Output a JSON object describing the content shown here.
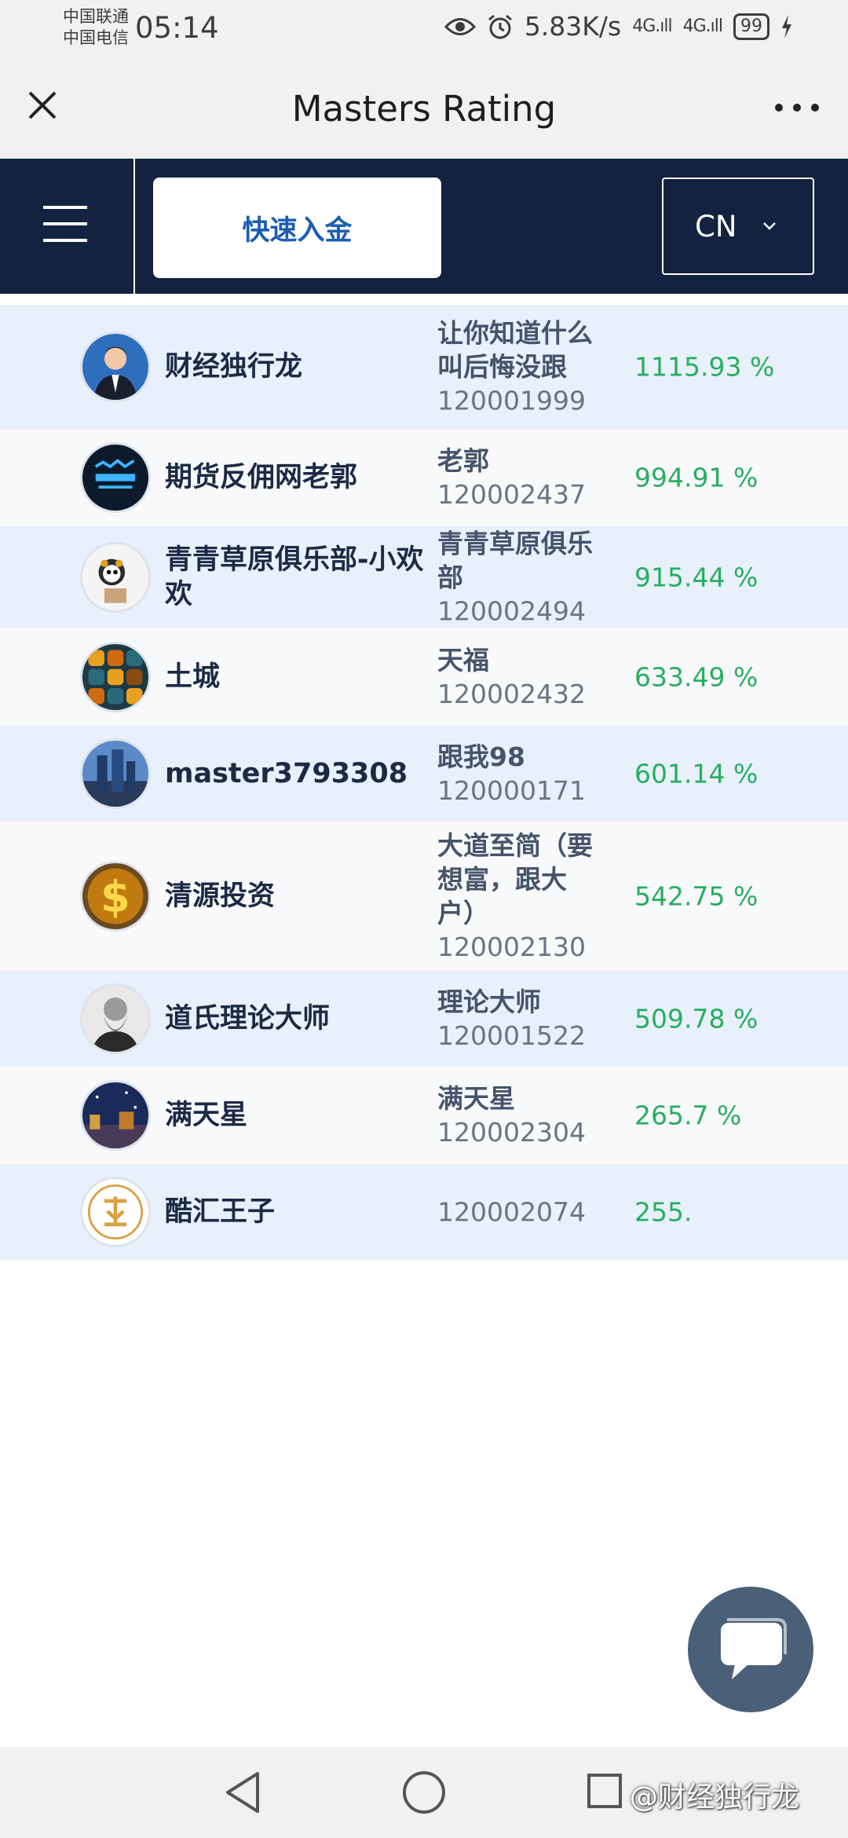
{
  "status_bar": {
    "carrier1": "中国联通",
    "carrier2": "中国电信",
    "time": "05:14",
    "net_speed": "5.83K/s",
    "signal1": "4G.ıll",
    "signal2": "4G.ıll",
    "battery": "99"
  },
  "app_bar": {
    "title": "Masters Rating",
    "close_icon": "close-icon",
    "more_icon": "more-icon"
  },
  "nav": {
    "deposit_label": "快速入金",
    "language": "CN"
  },
  "rows": [
    {
      "name": "财经独行龙",
      "strategy_name": "让你知道什么叫后悔没跟",
      "strategy_id": "120001999",
      "gain": "1115.93 %"
    },
    {
      "name": "期货反佣网老郭",
      "strategy_name": "老郭",
      "strategy_id": "120002437",
      "gain": "994.91 %"
    },
    {
      "name": "青青草原俱乐部-小欢欢",
      "strategy_name": "青青草原俱乐部",
      "strategy_id": "120002494",
      "gain": "915.44 %"
    },
    {
      "name": "土城",
      "strategy_name": "天福",
      "strategy_id": "120002432",
      "gain": "633.49 %"
    },
    {
      "name": "master3793308",
      "strategy_name": "跟我98",
      "strategy_id": "120000171",
      "gain": "601.14 %"
    },
    {
      "name": "清源投资",
      "strategy_name": "大道至简（要想富，跟大户）",
      "strategy_id": "120002130",
      "gain": "542.75 %"
    },
    {
      "name": "道氏理论大师",
      "strategy_name": "理论大师",
      "strategy_id": "120001522",
      "gain": "509.78 %"
    },
    {
      "name": "满天星",
      "strategy_name": "满天星",
      "strategy_id": "120002304",
      "gain": "265.7 %"
    },
    {
      "name": "酷汇王子",
      "strategy_name": "",
      "strategy_id": "120002074",
      "gain": "255."
    }
  ],
  "watermark": "@财经独行龙",
  "colors": {
    "nav_bg": "#122240",
    "gain_green": "#27ae60",
    "row_alt": "#e8f0fb",
    "button_blue": "#1c5db3"
  }
}
